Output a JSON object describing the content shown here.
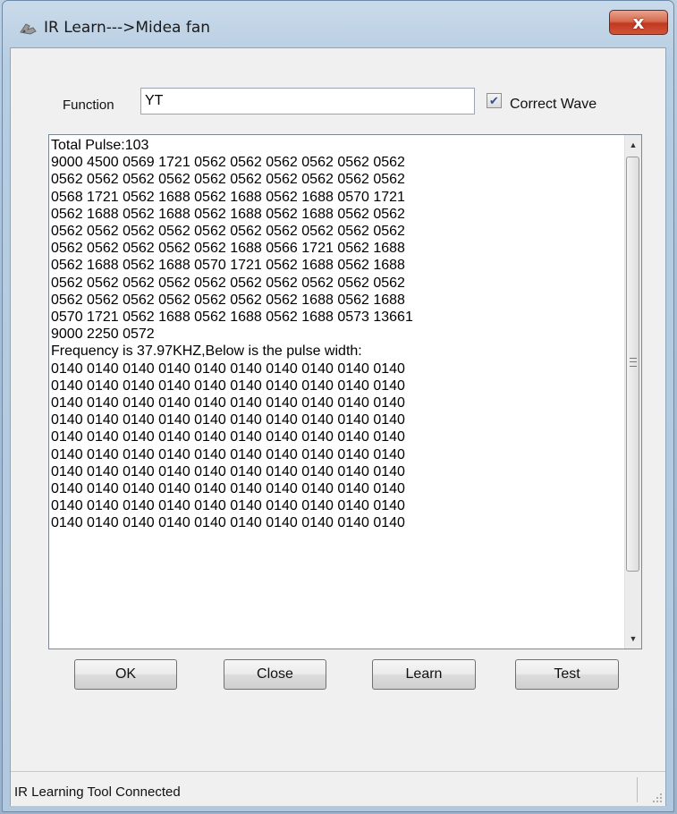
{
  "window": {
    "title": "IR Learn--->Midea fan",
    "close_glyph": "x"
  },
  "form": {
    "function_label": "Function",
    "function_value": "YT",
    "correct_wave_label": "Correct Wave",
    "correct_wave_checked": true
  },
  "output": {
    "lines": [
      "Total Pulse:103",
      "9000 4500 0569 1721 0562 0562 0562 0562 0562 0562",
      "0562 0562 0562 0562 0562 0562 0562 0562 0562 0562",
      "0568 1721 0562 1688 0562 1688 0562 1688 0570 1721",
      "0562 1688 0562 1688 0562 1688 0562 1688 0562 0562",
      "0562 0562 0562 0562 0562 0562 0562 0562 0562 0562",
      "0562 0562 0562 0562 0562 1688 0566 1721 0562 1688",
      "0562 1688 0562 1688 0570 1721 0562 1688 0562 1688",
      "0562 0562 0562 0562 0562 0562 0562 0562 0562 0562",
      "0562 0562 0562 0562 0562 0562 0562 1688 0562 1688",
      "0570 1721 0562 1688 0562 1688 0562 1688 0573 13661",
      "9000 2250 0572",
      "Frequency is 37.97KHZ,Below is the pulse width:",
      "0140 0140 0140 0140 0140 0140 0140 0140 0140 0140",
      "0140 0140 0140 0140 0140 0140 0140 0140 0140 0140",
      "0140 0140 0140 0140 0140 0140 0140 0140 0140 0140",
      "0140 0140 0140 0140 0140 0140 0140 0140 0140 0140",
      "0140 0140 0140 0140 0140 0140 0140 0140 0140 0140",
      "0140 0140 0140 0140 0140 0140 0140 0140 0140 0140",
      "0140 0140 0140 0140 0140 0140 0140 0140 0140 0140",
      "0140 0140 0140 0140 0140 0140 0140 0140 0140 0140",
      "0140 0140 0140 0140 0140 0140 0140 0140 0140 0140",
      "0140 0140 0140 0140 0140 0140 0140 0140 0140 0140"
    ]
  },
  "buttons": {
    "ok": "OK",
    "close": "Close",
    "learn": "Learn",
    "test": "Test"
  },
  "status": {
    "text": "IR Learning Tool Connected"
  },
  "icons": {
    "app": "ir-remote-icon",
    "checkmark": "checkmark-icon"
  },
  "colors": {
    "close_button": "#c8452a",
    "window_frame": "#b7cde2",
    "client_bg": "#f0f0f0"
  }
}
